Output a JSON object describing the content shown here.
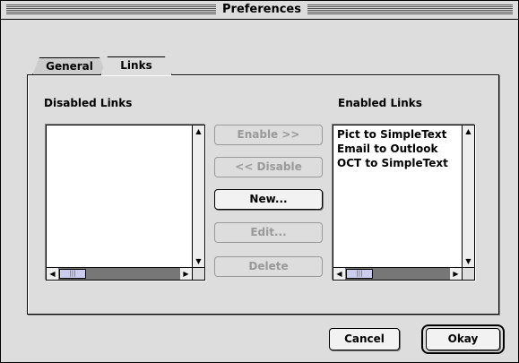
{
  "window": {
    "title": "Preferences"
  },
  "tabs": [
    {
      "label": "General",
      "active": false
    },
    {
      "label": "Links",
      "active": true
    }
  ],
  "disabled_links": {
    "heading": "Disabled Links",
    "items": []
  },
  "enabled_links": {
    "heading": "Enabled Links",
    "items": [
      "Pict to SimpleText",
      "Email to Outlook",
      "OCT to SimpleText"
    ]
  },
  "actions": {
    "enable": {
      "label": "Enable >>",
      "enabled": false
    },
    "disable": {
      "label": "<< Disable",
      "enabled": false
    },
    "new": {
      "label": "New...",
      "enabled": true
    },
    "edit": {
      "label": "Edit...",
      "enabled": false
    },
    "delete": {
      "label": "Delete",
      "enabled": false
    }
  },
  "footer": {
    "cancel_label": "Cancel",
    "okay_label": "Okay"
  },
  "icons": {
    "scroll_up": "arrow-up-icon",
    "scroll_down": "arrow-down-icon",
    "scroll_left": "arrow-left-icon",
    "scroll_right": "arrow-right-icon",
    "thumb": "scroll-thumb-grip-icon"
  },
  "colors": {
    "window_bg": "#dddddd",
    "list_bg": "#ffffff",
    "disabled_text": "#999999"
  }
}
